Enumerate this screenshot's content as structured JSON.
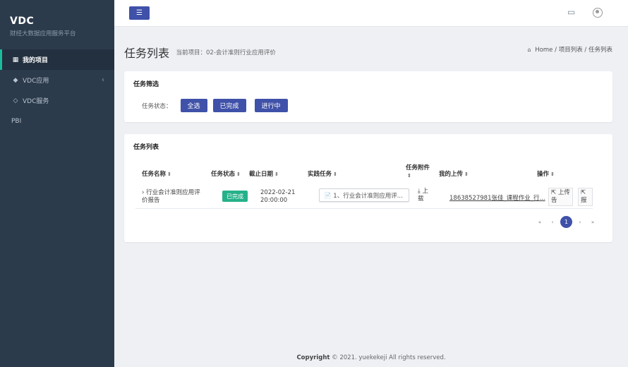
{
  "brand": {
    "title": "VDC",
    "subtitle": "财经大数据应用服务平台"
  },
  "sidebar": {
    "items": [
      {
        "label": "我的项目",
        "icon": "grid-icon",
        "active": true
      },
      {
        "label": "VDC应用",
        "icon": "cube-icon",
        "has_children": true
      },
      {
        "label": "VDC服务",
        "icon": "diamond-icon"
      },
      {
        "label": "PBI"
      }
    ]
  },
  "topbar": {
    "menu_icon": "hamburger-icon",
    "screen_icon": "monitor-icon",
    "user_icon": "user-icon"
  },
  "header": {
    "title": "任务列表",
    "subtitle": "当前项目：02-会计准则行业应用评价",
    "breadcrumb": {
      "home": "Home",
      "sep1": "/",
      "item1": "项目列表",
      "sep2": "/",
      "item2": "任务列表"
    }
  },
  "filter": {
    "title": "任务筛选",
    "label": "任务状态：",
    "buttons": [
      "全选",
      "已完成",
      "进行中"
    ]
  },
  "tasks": {
    "title": "任务列表",
    "columns": [
      "任务名称",
      "任务状态",
      "截止日期",
      "实践任务",
      "任务附件",
      "我的上传",
      "操作"
    ],
    "rows": [
      {
        "name_line1": "› 行业会计准则应用评",
        "name_line2": "价报告",
        "status": "已完成",
        "deadline_line1": "2022-02-21",
        "deadline_line2": "20:00:00",
        "practice": "📄 1、行业会计准则应用评...",
        "attach_line1": "⤓ 上",
        "attach_line2": "载",
        "my_upload": "18638527981张佳_课程作业_行...",
        "action_upload_line1": "⇱ 上传",
        "action_upload_line2": "告",
        "action_report": "⇱ 报"
      }
    ],
    "pagination": {
      "first": "«",
      "prev": "‹",
      "current": "1",
      "next": "›",
      "last": "»"
    }
  },
  "footer": {
    "copyright": "Copyright",
    "text": "© 2021. yuekekeji All rights reserved."
  },
  "colors": {
    "sidebar": "#2c3b4c",
    "accent": "#3f51a8",
    "success": "#26b18a",
    "active_border": "#1abc9c"
  }
}
